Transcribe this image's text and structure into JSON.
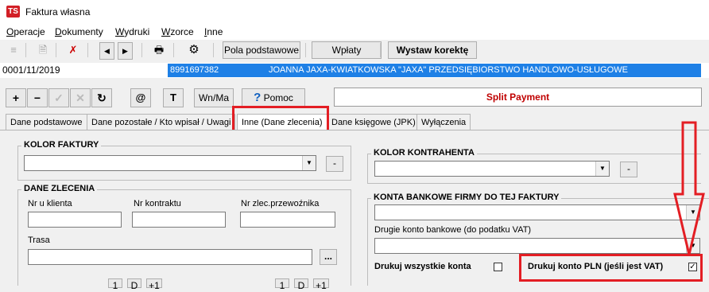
{
  "window": {
    "app_icon": "TS",
    "title": "Faktura własna"
  },
  "menu": [
    "Operacje",
    "Dokumenty",
    "Wydruki",
    "Wzorce",
    "Inne"
  ],
  "toolbar": {
    "pola_podstawowe": "Pola podstawowe",
    "wplaty": "Wpłaty",
    "wystaw_korekte": "Wystaw korektę"
  },
  "record": {
    "number": "0001/11/2019",
    "nip": "8991697382",
    "name": "JOANNA JAXA-KWIATKOWSKA \"JAXA\" PRZEDSIĘBIORSTWO HANDLOWO-USŁUGOWE"
  },
  "toolbar2": {
    "at": "@",
    "t": "T",
    "wn_ma": "Wn/Ma",
    "pomoc": "Pomoc",
    "split_payment": "Split Payment"
  },
  "tabs": [
    "Dane podstawowe",
    "Dane pozostałe / Kto wpisał / Uwagi",
    "Inne (Dane zlecenia)",
    "Dane księgowe (JPK)",
    "Wyłączenia"
  ],
  "kolor_faktury": {
    "label": "KOLOR FAKTURY",
    "btn": "-"
  },
  "kolor_kontrahenta": {
    "label": "KOLOR KONTRAHENTA",
    "btn": "-"
  },
  "dane_zlecenia": {
    "label": "DANE ZLECENIA",
    "nr_u_klienta": "Nr u klienta",
    "nr_kontraktu": "Nr kontraktu",
    "nr_zlec_przewoznika": "Nr zlec.przewoźnika",
    "trasa": "Trasa",
    "trasa_btn": "..."
  },
  "konta_bankowe": {
    "label": "KONTA BANKOWE FIRMY DO TEJ FAKTURY",
    "drugie_konto": "Drugie konto bankowe (do podatku VAT)",
    "drukuj_wszystkie": "Drukuj wszystkie konta",
    "drukuj_wszystkie_checked": false,
    "drukuj_pln": "Drukuj konto PLN (jeśli jest VAT)",
    "drukuj_pln_checked": true
  },
  "bottom_partial": {
    "btn1": "1",
    "btn_d": "D",
    "btn_plus1": "+1"
  },
  "colors": {
    "highlight": "#e31e24",
    "record_bar": "#1e80e6",
    "split_text": "#c00000"
  }
}
